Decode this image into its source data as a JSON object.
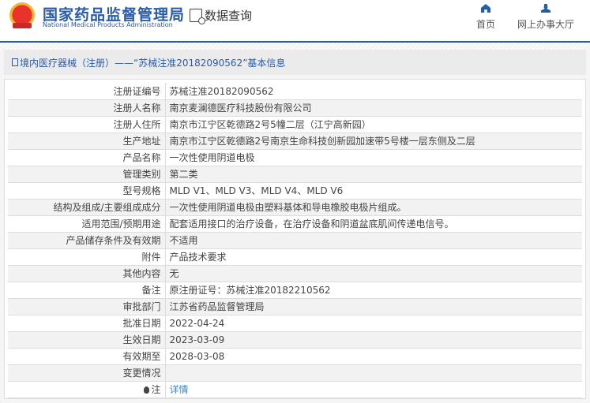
{
  "header": {
    "site_name": "国家药品监督管理局",
    "site_name_en": "National Medical Products Administration",
    "query_label": "数据查询",
    "nav": [
      {
        "label": "首页",
        "icon": "home-icon"
      },
      {
        "label": "网上办事大厅",
        "icon": "user-icon"
      }
    ]
  },
  "title": "境内医疗器械（注册）——“苏械注准20182090562”基本信息",
  "rows": [
    {
      "k": "注册证编号",
      "v": "苏械注准20182090562"
    },
    {
      "k": "注册人名称",
      "v": "南京麦澜德医疗科技股份有限公司"
    },
    {
      "k": "注册人住所",
      "v": "南京市江宁区乾德路2号5幢二层（江宁高新园）"
    },
    {
      "k": "生产地址",
      "v": "南京市江宁区乾德路2号南京生命科技创新园加速带5号楼一层东侧及二层"
    },
    {
      "k": "产品名称",
      "v": "一次性使用阴道电极"
    },
    {
      "k": "管理类别",
      "v": "第二类"
    },
    {
      "k": "型号规格",
      "v": "MLD V1、MLD V3、MLD V4、MLD V6"
    },
    {
      "k": "结构及组成/主要组成成分",
      "v": "一次性使用阴道电极由塑料基体和导电橡胶电极片组成。"
    },
    {
      "k": "适用范围/预期用途",
      "v": "配套适用接口的治疗设备，在治疗设备和阴道盆底肌间传递电信号。"
    },
    {
      "k": "产品储存条件及有效期",
      "v": "不适用"
    },
    {
      "k": "附件",
      "v": "产品技术要求"
    },
    {
      "k": "其他内容",
      "v": "无"
    },
    {
      "k": "备注",
      "v": "原注册证号：苏械注准20182210562"
    },
    {
      "k": "审批部门",
      "v": "江苏省药品监督管理局"
    },
    {
      "k": "批准日期",
      "v": "2022-04-24"
    },
    {
      "k": "生效日期",
      "v": "2023-03-09"
    },
    {
      "k": "有效期至",
      "v": "2028-03-08"
    },
    {
      "k": "变更情况",
      "v": ""
    }
  ],
  "note": {
    "k": "注",
    "link": "详情"
  }
}
